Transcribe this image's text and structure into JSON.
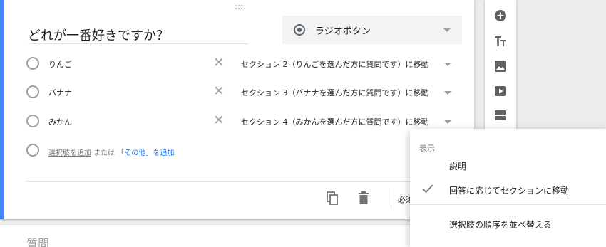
{
  "question": {
    "title": "どれが一番好きですか？",
    "type_label": "ラジオボタン"
  },
  "options": [
    {
      "label": "りんご",
      "goto": "セクション 2（りんごを選んだ方に質問です）に移動"
    },
    {
      "label": "バナナ",
      "goto": "セクション 3（バナナを選んだ方に質問です）に移動"
    },
    {
      "label": "みかん",
      "goto": "セクション 4（みかんを選んだ方に質問です）に移動"
    }
  ],
  "add_option": {
    "add_label": "選択肢を追加",
    "or_text": "または",
    "other_label": "「その他」を追加"
  },
  "footer": {
    "required_label": "必須"
  },
  "next_question": {
    "title": "質問"
  },
  "menu": {
    "header": "表示",
    "items": [
      {
        "label": "説明"
      },
      {
        "label": "回答に応じてセクションに移動",
        "checked": true
      },
      {
        "label": "選択肢の順序を並べ替える"
      }
    ]
  },
  "toolbar_icons": [
    "add-circle-icon",
    "title-text-icon",
    "image-icon",
    "video-icon",
    "section-icon"
  ],
  "colors": {
    "accent": "#4285f4",
    "link": "#1a73e8"
  }
}
